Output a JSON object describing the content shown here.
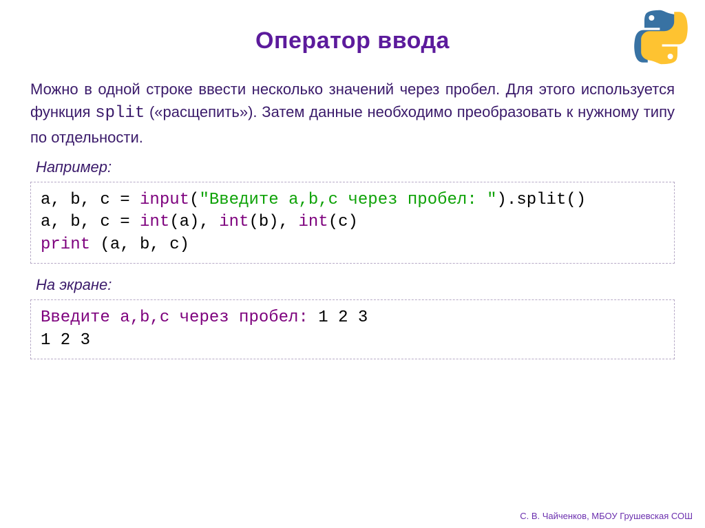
{
  "title": "Оператор ввода",
  "paragraph": {
    "pre": "Можно в одной строке ввести несколько значений через пробел. Для этого используется функция ",
    "mono": "split",
    "post": " («расщепить»). Затем данные необходимо преобразовать к нужному типу по отдельности."
  },
  "label_example": "Например:",
  "code1": {
    "l1a": "a, b, c = ",
    "l1b": "input",
    "l1c": "(",
    "l1d": "\"Введите a,b,c через пробел: \"",
    "l1e": ").split()",
    "l2a": "a, b, c = ",
    "l2b": "int",
    "l2c": "(a), ",
    "l2d": "int",
    "l2e": "(b), ",
    "l2f": "int",
    "l2g": "(c)",
    "l3a": "print",
    "l3b": " (a, b, c)"
  },
  "label_screen": "На экране:",
  "code2": {
    "l1a": "Введите a,b,c через пробел: ",
    "l1b": "1 2 3",
    "l2": "1 2 3"
  },
  "footer": "С. В. Чайченков, МБОУ Грушевская СОШ"
}
